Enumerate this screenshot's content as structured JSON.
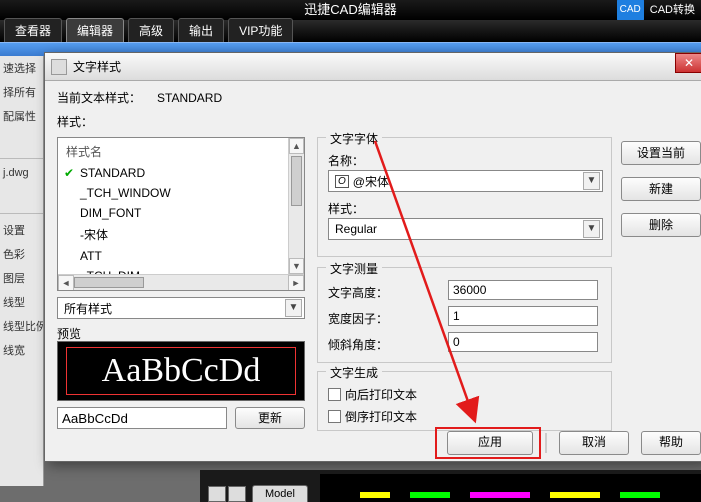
{
  "app": {
    "title": "迅捷CAD编辑器",
    "cad_badge": "CAD",
    "cad_convert": "CAD转换"
  },
  "ribbon": {
    "tabs": [
      "查看器",
      "编辑器",
      "高级",
      "输出",
      "VIP功能"
    ],
    "active_index": 1
  },
  "sidebar": {
    "items": [
      "速选择",
      "择所有",
      "配属性",
      "",
      "j.dwg",
      "",
      "设置",
      "色彩",
      "图层",
      "线型",
      "线型比例",
      "线宽"
    ]
  },
  "dialog": {
    "title": "文字样式",
    "current_label": "当前文本样式：",
    "current_value": "STANDARD",
    "styles_label": "样式：",
    "style_header": "样式名",
    "styles": [
      "STANDARD",
      "_TCH_WINDOW",
      "DIM_FONT",
      "-宋体",
      "ATT",
      "_TCH_DIM"
    ],
    "current_style_index": 0,
    "filter_label": "所有样式",
    "preview_label": "预览",
    "preview_text": "AaBbCcDd",
    "preview_input": "AaBbCcDd",
    "update_btn": "更新",
    "font_group": {
      "legend": "文字字体",
      "name_label": "名称：",
      "name_value": "@宋体",
      "style_label": "样式：",
      "style_value": "Regular"
    },
    "measure_group": {
      "legend": "文字测量",
      "height_label": "文字高度：",
      "height_value": "36000",
      "width_label": "宽度因子：",
      "width_value": "1",
      "oblique_label": "倾斜角度：",
      "oblique_value": "0"
    },
    "gen_group": {
      "legend": "文字生成",
      "backwards_label": "向后打印文本",
      "upside_label": "倒序打印文本"
    },
    "action_buttons": {
      "set_current": "设置当前",
      "new": "新建",
      "delete": "删除"
    },
    "bottom_buttons": {
      "apply": "应用",
      "cancel": "取消",
      "help": "帮助"
    }
  },
  "model_tab": "Model"
}
